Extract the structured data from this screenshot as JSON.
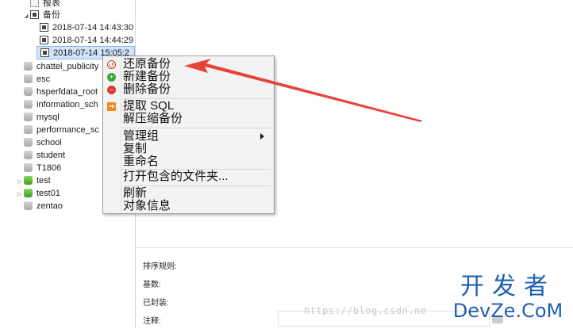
{
  "tree": {
    "report": "报表",
    "backup_group": "备份",
    "backups": [
      "2018-07-14 14:43:30",
      "2018-07-14 14:44:29",
      "2018-07-14 15:05:2"
    ],
    "databases": [
      {
        "label": "chattel_publicity",
        "kind": "grey",
        "expandable": false
      },
      {
        "label": "esc",
        "kind": "grey",
        "expandable": false
      },
      {
        "label": "hsperfdata_root",
        "kind": "grey",
        "expandable": false
      },
      {
        "label": "information_sch",
        "kind": "grey",
        "expandable": false
      },
      {
        "label": "mysql",
        "kind": "grey",
        "expandable": false
      },
      {
        "label": "performance_sc",
        "kind": "grey",
        "expandable": false
      },
      {
        "label": "school",
        "kind": "grey",
        "expandable": false
      },
      {
        "label": "student",
        "kind": "grey",
        "expandable": false
      },
      {
        "label": "T1806",
        "kind": "grey",
        "expandable": false
      },
      {
        "label": "test",
        "kind": "green",
        "expandable": true
      },
      {
        "label": "test01",
        "kind": "green",
        "expandable": true
      },
      {
        "label": "zentao",
        "kind": "grey",
        "expandable": false
      }
    ]
  },
  "context_menu": {
    "restore_backup": "还原备份",
    "new_backup": "新建备份",
    "delete_backup": "删除备份",
    "extract_sql": "提取 SQL",
    "decompress_backup": "解压缩备份",
    "manage_group": "管理组",
    "copy": "复制",
    "rename": "重命名",
    "open_folder": "打开包含的文件夹...",
    "refresh": "刷新",
    "object_info": "对象信息"
  },
  "properties": {
    "sort_rule": "排序规则:",
    "base": "基数:",
    "sealed": "已封装:",
    "comment": "注释:"
  },
  "watermark": {
    "url": "https://blog.csdn.ne",
    "brand_cn": "开发者",
    "brand_en": "DevZe.CoM"
  },
  "colors": {
    "selection": "#cfe3fa",
    "annotation_arrow": "#e8423a",
    "brand": "#1f5fb0"
  }
}
